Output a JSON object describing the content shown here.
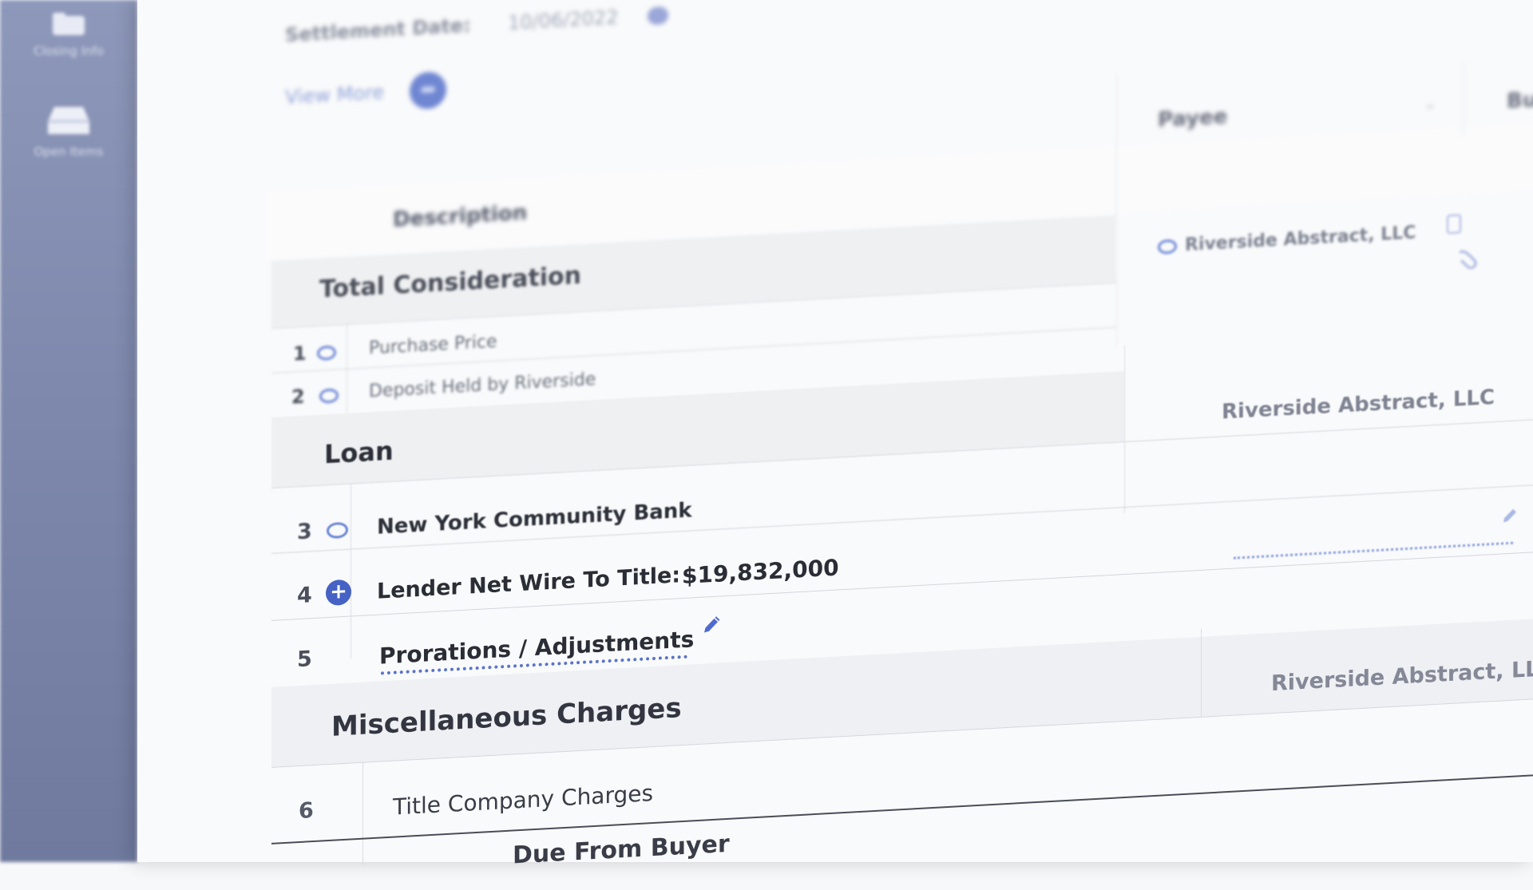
{
  "sidebar": {
    "items": [
      {
        "label": "Closing Info",
        "icon": "folder-icon"
      },
      {
        "label": "Open Items",
        "icon": "inbox-icon"
      }
    ]
  },
  "header": {
    "settlement_label": "Settlement Date:",
    "settlement_value": "10/06/2022",
    "view_more": "View More"
  },
  "columns": {
    "description": "Description",
    "payee": "Payee",
    "extra": "Bu"
  },
  "sections": {
    "total_consideration": {
      "title": "Total Consideration",
      "payee": "Riverside Abstract, LLC",
      "rows": [
        {
          "num": "1",
          "description": "Purchase Price"
        },
        {
          "num": "2",
          "description": "Deposit Held by Riverside"
        }
      ]
    },
    "loan": {
      "title": "Loan",
      "payee": "Riverside Abstract, LLC",
      "rows": [
        {
          "num": "3",
          "description": "New York Community Bank"
        },
        {
          "num": "4",
          "description": "Lender Net Wire To Title:",
          "amount": "$19,832,000"
        },
        {
          "num": "5",
          "description": "Prorations / Adjustments"
        }
      ]
    },
    "misc": {
      "title": "Miscellaneous Charges",
      "payee": "Riverside Abstract, LLC",
      "rows": [
        {
          "num": "6",
          "description": "Title Company Charges"
        }
      ]
    },
    "due_from_buyer": {
      "title": "Due From Buyer"
    }
  },
  "colors": {
    "accent": "#4562C4",
    "sidebar": "#7E89AD",
    "dotted_underline": "#5A73CC"
  }
}
